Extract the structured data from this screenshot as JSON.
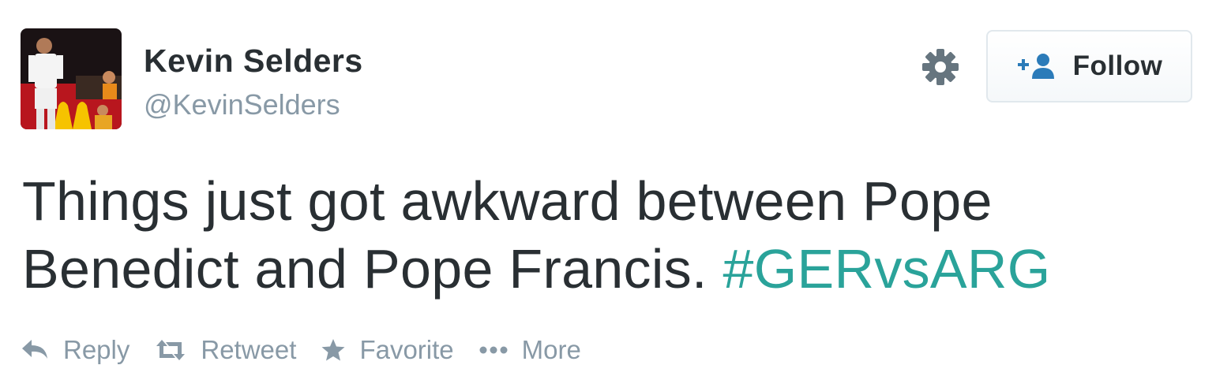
{
  "tweet": {
    "author": {
      "display_name": "Kevin Selders",
      "screen_name": "@KevinSelders",
      "avatar": "player-photo-avatar"
    },
    "header": {
      "settings_icon": "gear-icon",
      "follow_icon": "add-user-icon",
      "follow_label": "Follow"
    },
    "text": {
      "body": "Things just got awkward between Pope Benedict and Pope Francis. ",
      "hashtag": "#GERvsARG"
    },
    "actions": [
      {
        "label": "Reply",
        "icon": "reply-icon"
      },
      {
        "label": "Retweet",
        "icon": "retweet-icon"
      },
      {
        "label": "Favorite",
        "icon": "star-icon"
      },
      {
        "label": "More",
        "icon": "more-dots-icon"
      }
    ],
    "colors": {
      "text": "#292f33",
      "muted": "#8899a6",
      "hashtag": "#2aa39a",
      "border": "#e1e8ed"
    }
  }
}
